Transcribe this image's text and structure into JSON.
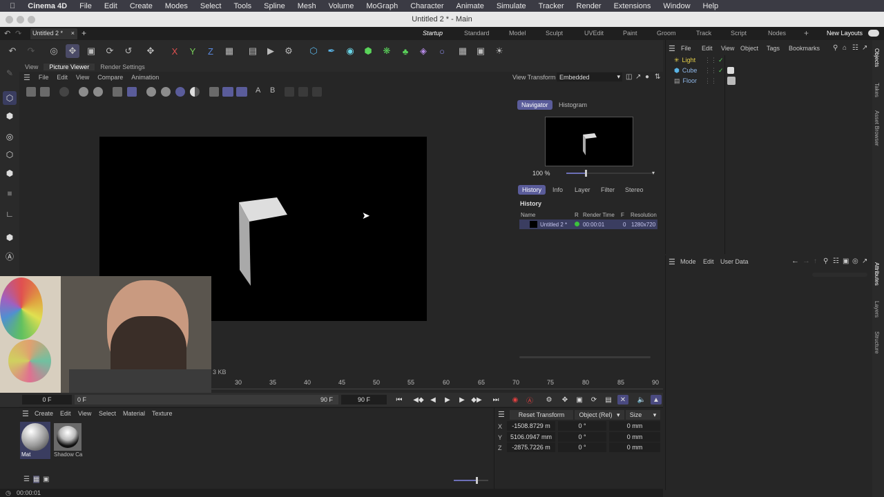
{
  "menubar": {
    "app_name": "Cinema 4D",
    "items": [
      "File",
      "Edit",
      "Create",
      "Modes",
      "Select",
      "Tools",
      "Spline",
      "Mesh",
      "Volume",
      "MoGraph",
      "Character",
      "Animate",
      "Simulate",
      "Tracker",
      "Render",
      "Extensions",
      "Window",
      "Help"
    ]
  },
  "window": {
    "title": "Untitled 2 * - Main"
  },
  "tabbar": {
    "doc_tab": "Untitled 2 *",
    "layouts": [
      "Startup",
      "Standard",
      "Model",
      "Sculpt",
      "UVEdit",
      "Paint",
      "Groom",
      "Track",
      "Script",
      "Nodes"
    ],
    "active_layout": "Startup",
    "new_layouts": "New Layouts"
  },
  "toolbar": {
    "axis_labels": [
      "X",
      "Y",
      "Z"
    ]
  },
  "picture_viewer": {
    "tabs": [
      "View",
      "Picture Viewer",
      "Render Settings"
    ],
    "active_tab": "Picture Viewer",
    "menu": [
      "File",
      "Edit",
      "View",
      "Compare",
      "Animation"
    ],
    "view_transform_label": "View Transform",
    "view_transform_value": "Embedded",
    "ab_labels": [
      "A",
      "B"
    ],
    "memory_fragment": "3 KB"
  },
  "navigator": {
    "tabs": [
      "Navigator",
      "Histogram"
    ],
    "zoom": "100 %",
    "lower_tabs": [
      "History",
      "Info",
      "Layer",
      "Filter",
      "Stereo"
    ],
    "section_title": "History",
    "columns": [
      "Name",
      "R",
      "Render Time",
      "F",
      "Resolution"
    ],
    "row": {
      "name": "Untitled 2 *",
      "time": "00:00:01",
      "frame": "0",
      "resolution": "1280x720"
    },
    "status_color": "#3cc23c"
  },
  "objects": {
    "menu": [
      "File",
      "Edit",
      "View",
      "Object",
      "Tags",
      "Bookmarks"
    ],
    "items": [
      {
        "name": "Light",
        "color": "#e8d24a"
      },
      {
        "name": "Cube",
        "color": "#8fb7e8"
      },
      {
        "name": "Floor",
        "color": "#8fb7e8"
      }
    ]
  },
  "attributes": {
    "menu": [
      "Mode",
      "Edit",
      "User Data"
    ]
  },
  "side_tabs": [
    "Objects",
    "Takes",
    "Asset Browser",
    "Attributes",
    "Layers",
    "Structure"
  ],
  "timeline": {
    "ticks": [
      "30",
      "35",
      "40",
      "45",
      "50",
      "55",
      "60",
      "65",
      "70",
      "75",
      "80",
      "85",
      "90"
    ]
  },
  "transport": {
    "current_frame": "0 F",
    "start_frame": "0 F",
    "end_frame_left": "90 F",
    "end_frame_right": "90 F"
  },
  "materials": {
    "menu": [
      "Create",
      "Edit",
      "View",
      "Select",
      "Material",
      "Texture"
    ],
    "items": [
      {
        "name": "Mat"
      },
      {
        "name": "Shadow Ca"
      }
    ]
  },
  "coordinates": {
    "reset_label": "Reset Transform",
    "mode": "Object (Rel)",
    "size_mode": "Size",
    "rows": [
      {
        "axis": "X",
        "pos": "-1508.8729 m",
        "rot": "0 °",
        "size": "0 mm"
      },
      {
        "axis": "Y",
        "pos": "5106.0947 mm",
        "rot": "0 °",
        "size": "0 mm"
      },
      {
        "axis": "Z",
        "pos": "-2875.7226 m",
        "rot": "0 °",
        "size": "0 mm"
      }
    ]
  },
  "status": {
    "time": "00:00:01"
  }
}
